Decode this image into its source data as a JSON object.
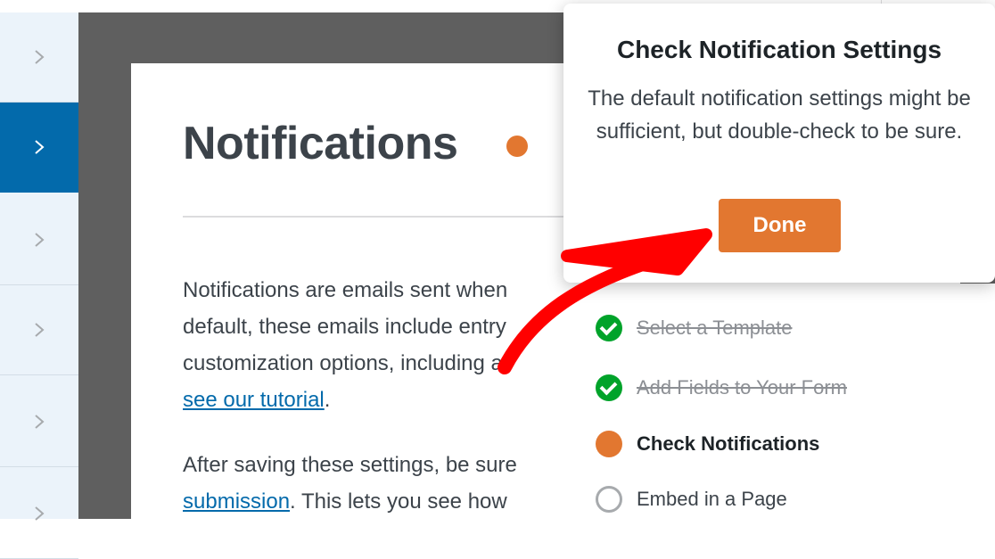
{
  "page": {
    "title": "Notifications"
  },
  "content": {
    "paragraph1_lines": [
      "Notifications are emails sent when",
      "default, these emails include entry",
      "customization options, including a"
    ],
    "paragraph1_link": "see our tutorial",
    "paragraph1_after_link": ".",
    "paragraph2_line1": "After saving these settings, be sure",
    "paragraph2_link": "submission",
    "paragraph2_after_link": ". This lets you see how"
  },
  "popover": {
    "title": "Check Notification Settings",
    "body": "The default notification settings might be sufficient, but double-check to be sure.",
    "button_label": "Done"
  },
  "checklist": {
    "items": [
      {
        "label": "Select a Template",
        "state": "done"
      },
      {
        "label": "Add Fields to Your Form",
        "state": "done"
      },
      {
        "label": "Check Notifications",
        "state": "current"
      },
      {
        "label": "Embed in a Page",
        "state": "todo"
      }
    ]
  },
  "colors": {
    "accent_orange": "#e27730",
    "sidebar_active": "#036aab",
    "link": "#036aab",
    "success_green": "#00a32a",
    "annotation_red": "#ff0000"
  },
  "icons": {
    "sidebar_chevron": "chevron-right-icon",
    "done": "check-circle-icon",
    "current": "orange-dot-icon",
    "todo": "empty-circle-icon"
  }
}
